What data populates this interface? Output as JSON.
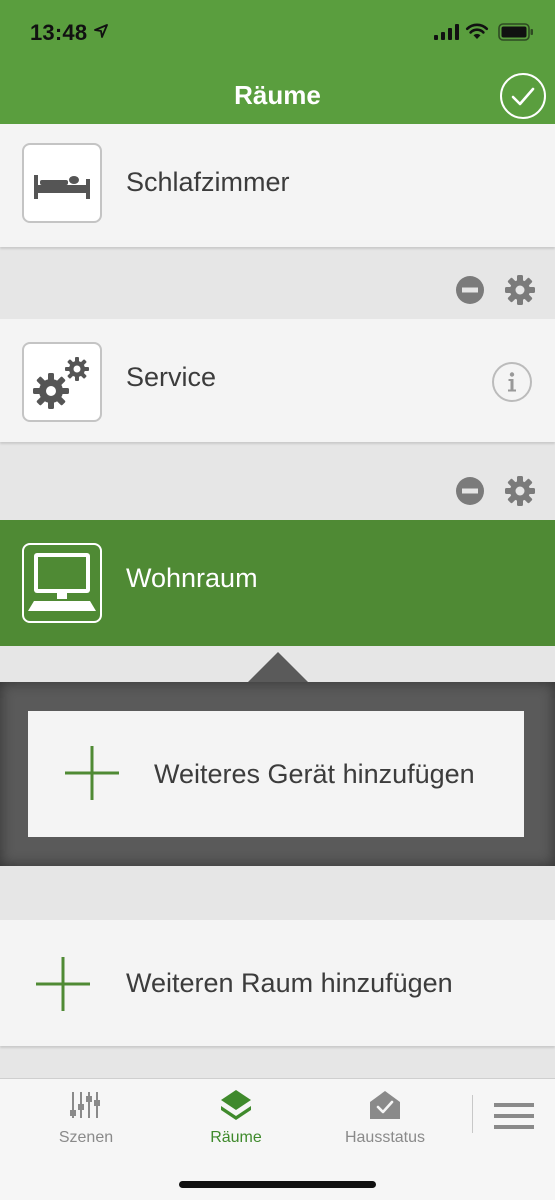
{
  "status_bar": {
    "time": "13:48"
  },
  "header": {
    "title": "Räume"
  },
  "rooms": [
    {
      "label": "Schlafzimmer",
      "icon": "bed-icon"
    },
    {
      "label": "Service",
      "icon": "gears-icon"
    },
    {
      "label": "Wohnraum",
      "icon": "computer-monitor-icon",
      "expanded": true
    }
  ],
  "expanded_panel": {
    "add_device_label": "Weiteres Gerät hinzufügen"
  },
  "add_room": {
    "label": "Weiteren Raum hinzufügen"
  },
  "tabbar": {
    "tabs": [
      {
        "label": "Szenen",
        "icon": "sliders-icon"
      },
      {
        "label": "Räume",
        "icon": "house-layers-icon",
        "active": true
      },
      {
        "label": "Hausstatus",
        "icon": "house-check-icon"
      }
    ]
  },
  "colors": {
    "brand_green": "#5a9e3e",
    "active_row": "#4f8a34",
    "panel_gray": "#5a5a5a"
  }
}
